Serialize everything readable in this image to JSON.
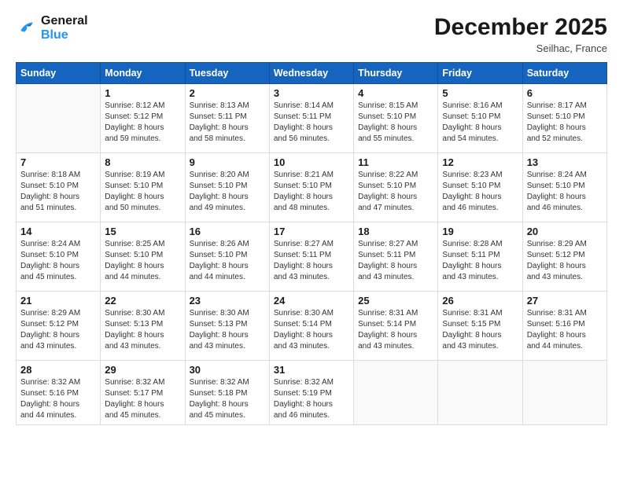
{
  "logo": {
    "line1": "General",
    "line2": "Blue"
  },
  "header": {
    "month": "December 2025",
    "location": "Seilhac, France"
  },
  "days_of_week": [
    "Sunday",
    "Monday",
    "Tuesday",
    "Wednesday",
    "Thursday",
    "Friday",
    "Saturday"
  ],
  "weeks": [
    [
      {
        "day": "",
        "info": ""
      },
      {
        "day": "1",
        "info": "Sunrise: 8:12 AM\nSunset: 5:12 PM\nDaylight: 8 hours\nand 59 minutes."
      },
      {
        "day": "2",
        "info": "Sunrise: 8:13 AM\nSunset: 5:11 PM\nDaylight: 8 hours\nand 58 minutes."
      },
      {
        "day": "3",
        "info": "Sunrise: 8:14 AM\nSunset: 5:11 PM\nDaylight: 8 hours\nand 56 minutes."
      },
      {
        "day": "4",
        "info": "Sunrise: 8:15 AM\nSunset: 5:10 PM\nDaylight: 8 hours\nand 55 minutes."
      },
      {
        "day": "5",
        "info": "Sunrise: 8:16 AM\nSunset: 5:10 PM\nDaylight: 8 hours\nand 54 minutes."
      },
      {
        "day": "6",
        "info": "Sunrise: 8:17 AM\nSunset: 5:10 PM\nDaylight: 8 hours\nand 52 minutes."
      }
    ],
    [
      {
        "day": "7",
        "info": ""
      },
      {
        "day": "8",
        "info": "Sunrise: 8:19 AM\nSunset: 5:10 PM\nDaylight: 8 hours\nand 50 minutes."
      },
      {
        "day": "9",
        "info": "Sunrise: 8:20 AM\nSunset: 5:10 PM\nDaylight: 8 hours\nand 49 minutes."
      },
      {
        "day": "10",
        "info": "Sunrise: 8:21 AM\nSunset: 5:10 PM\nDaylight: 8 hours\nand 48 minutes."
      },
      {
        "day": "11",
        "info": "Sunrise: 8:22 AM\nSunset: 5:10 PM\nDaylight: 8 hours\nand 47 minutes."
      },
      {
        "day": "12",
        "info": "Sunrise: 8:23 AM\nSunset: 5:10 PM\nDaylight: 8 hours\nand 46 minutes."
      },
      {
        "day": "13",
        "info": "Sunrise: 8:24 AM\nSunset: 5:10 PM\nDaylight: 8 hours\nand 46 minutes."
      }
    ],
    [
      {
        "day": "14",
        "info": ""
      },
      {
        "day": "15",
        "info": "Sunrise: 8:25 AM\nSunset: 5:10 PM\nDaylight: 8 hours\nand 44 minutes."
      },
      {
        "day": "16",
        "info": "Sunrise: 8:26 AM\nSunset: 5:10 PM\nDaylight: 8 hours\nand 44 minutes."
      },
      {
        "day": "17",
        "info": "Sunrise: 8:27 AM\nSunset: 5:11 PM\nDaylight: 8 hours\nand 43 minutes."
      },
      {
        "day": "18",
        "info": "Sunrise: 8:27 AM\nSunset: 5:11 PM\nDaylight: 8 hours\nand 43 minutes."
      },
      {
        "day": "19",
        "info": "Sunrise: 8:28 AM\nSunset: 5:11 PM\nDaylight: 8 hours\nand 43 minutes."
      },
      {
        "day": "20",
        "info": "Sunrise: 8:29 AM\nSunset: 5:12 PM\nDaylight: 8 hours\nand 43 minutes."
      }
    ],
    [
      {
        "day": "21",
        "info": ""
      },
      {
        "day": "22",
        "info": "Sunrise: 8:30 AM\nSunset: 5:13 PM\nDaylight: 8 hours\nand 43 minutes."
      },
      {
        "day": "23",
        "info": "Sunrise: 8:30 AM\nSunset: 5:13 PM\nDaylight: 8 hours\nand 43 minutes."
      },
      {
        "day": "24",
        "info": "Sunrise: 8:30 AM\nSunset: 5:14 PM\nDaylight: 8 hours\nand 43 minutes."
      },
      {
        "day": "25",
        "info": "Sunrise: 8:31 AM\nSunset: 5:14 PM\nDaylight: 8 hours\nand 43 minutes."
      },
      {
        "day": "26",
        "info": "Sunrise: 8:31 AM\nSunset: 5:15 PM\nDaylight: 8 hours\nand 43 minutes."
      },
      {
        "day": "27",
        "info": "Sunrise: 8:31 AM\nSunset: 5:16 PM\nDaylight: 8 hours\nand 44 minutes."
      }
    ],
    [
      {
        "day": "28",
        "info": "Sunrise: 8:32 AM\nSunset: 5:16 PM\nDaylight: 8 hours\nand 44 minutes."
      },
      {
        "day": "29",
        "info": "Sunrise: 8:32 AM\nSunset: 5:17 PM\nDaylight: 8 hours\nand 45 minutes."
      },
      {
        "day": "30",
        "info": "Sunrise: 8:32 AM\nSunset: 5:18 PM\nDaylight: 8 hours\nand 45 minutes."
      },
      {
        "day": "31",
        "info": "Sunrise: 8:32 AM\nSunset: 5:19 PM\nDaylight: 8 hours\nand 46 minutes."
      },
      {
        "day": "",
        "info": ""
      },
      {
        "day": "",
        "info": ""
      },
      {
        "day": "",
        "info": ""
      }
    ]
  ],
  "week7_info": "Sunrise: 8:18 AM\nSunset: 5:10 PM\nDaylight: 8 hours\nand 51 minutes.",
  "week14_info": "Sunrise: 8:24 AM\nSunset: 5:10 PM\nDaylight: 8 hours\nand 45 minutes.",
  "week21_info": "Sunrise: 8:29 AM\nSunset: 5:12 PM\nDaylight: 8 hours\nand 43 minutes."
}
